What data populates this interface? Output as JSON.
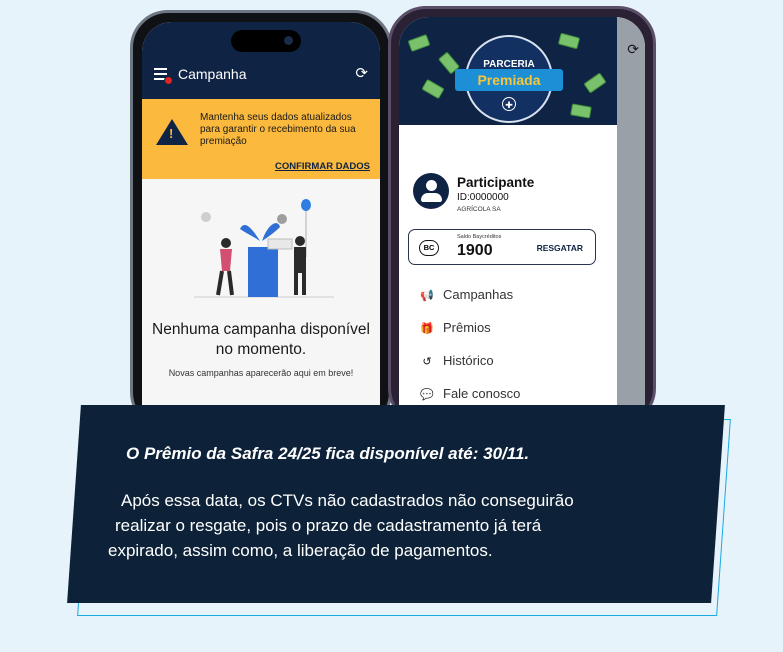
{
  "phone_left": {
    "header": {
      "title": "Campanha",
      "menu_icon": "menu-icon",
      "refresh_icon": "refresh-icon"
    },
    "alert": {
      "message": "Mantenha seus dados atualizados para garantir o recebimento da sua premiação",
      "action": "CONFIRMAR DADOS",
      "icon": "warning-icon",
      "color": "#fbb93d"
    },
    "empty_state": {
      "title": "Nenhuma campanha disponível no momento.",
      "subtitle": "Novas campanhas aparecerão aqui em breve!"
    }
  },
  "phone_right": {
    "banner": {
      "logo_top": "PARCERIA",
      "logo_main": "Premiada"
    },
    "participant": {
      "name": "Participante",
      "id": "ID:0000000",
      "company": "AGRÍCOLA SA"
    },
    "balance": {
      "badge": "BC",
      "label": "Saldo Baycréditos",
      "value": "1900",
      "action": "RESGATAR"
    },
    "menu": [
      {
        "label": "Campanhas",
        "icon": "megaphone-icon"
      },
      {
        "label": "Prêmios",
        "icon": "gift-icon"
      },
      {
        "label": "Histórico",
        "icon": "history-icon"
      },
      {
        "label": "Fale conosco",
        "icon": "chat-icon"
      }
    ]
  },
  "callout": {
    "title": "O Prêmio da Safra 24/25 fica disponível até: 30/11.",
    "body_lines": [
      "Após essa data, os CTVs não cadastrados não conseguirão",
      "realizar o resgate, pois o prazo de cadastramento já terá",
      "expirado, assim como, a liberação de pagamentos."
    ],
    "background_color": "#0d2238",
    "outline_color": "#1aa9df"
  }
}
